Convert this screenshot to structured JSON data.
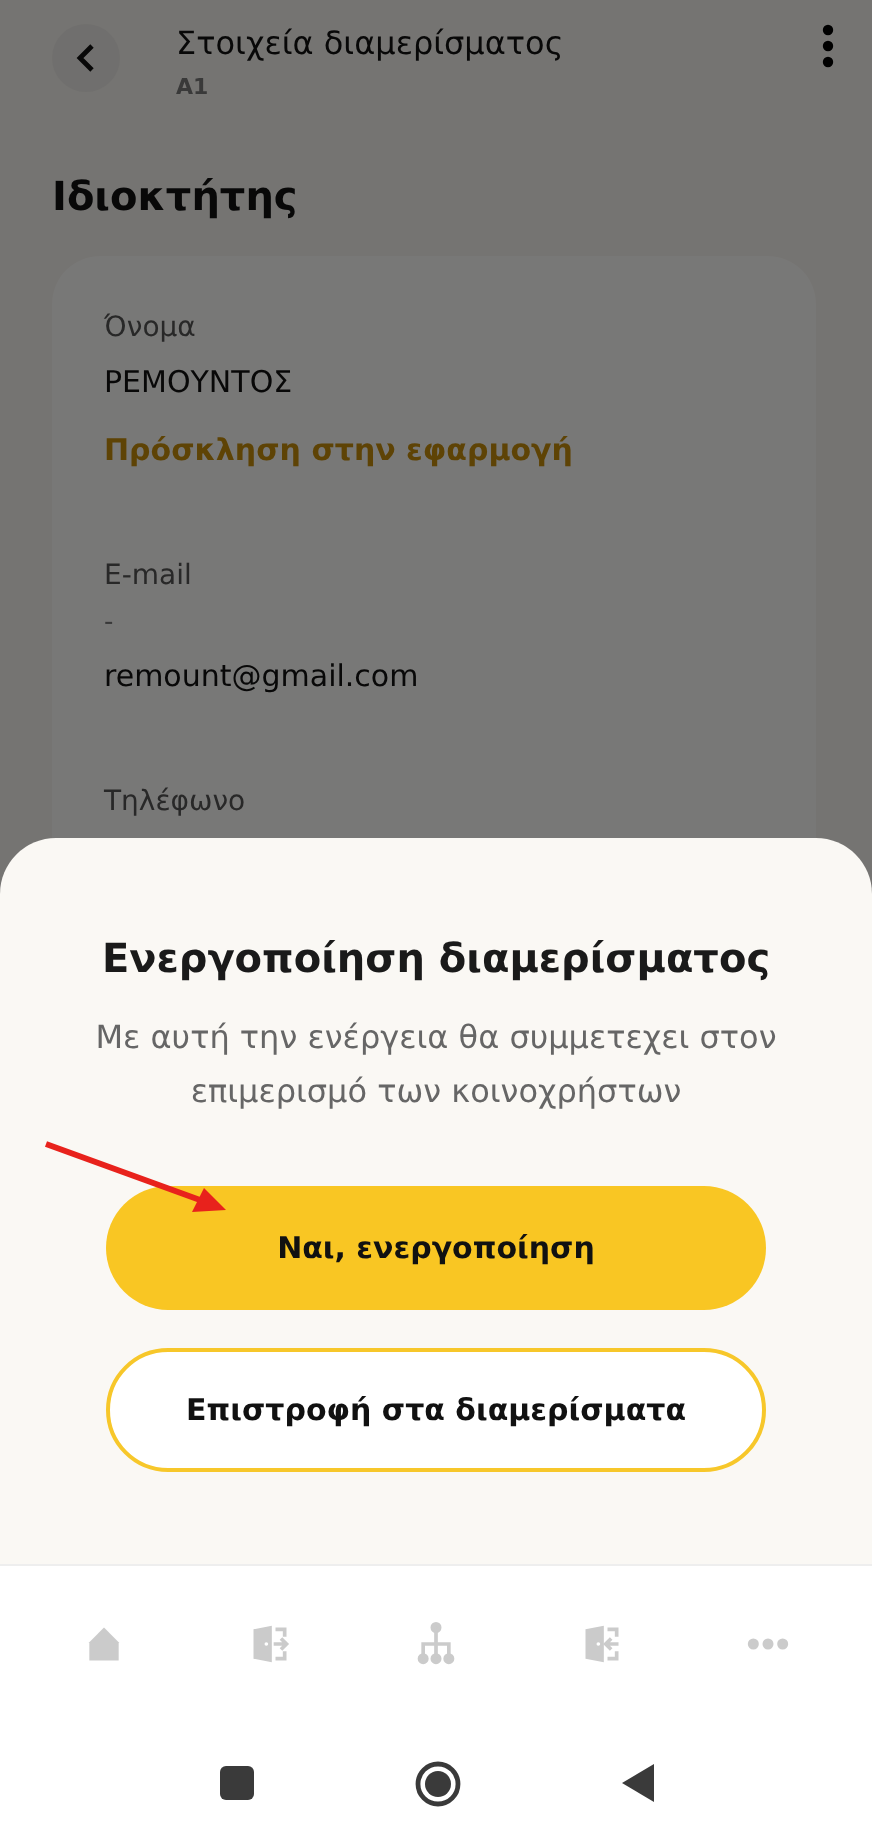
{
  "header": {
    "title": "Στοιχεία διαμερίσματος",
    "subtitle": "A1"
  },
  "section_title": "Ιδιοκτήτης",
  "owner_card": {
    "fields": [
      {
        "label": "Όνομα",
        "value": "ΡΕΜΟΥΝΤΟΣ",
        "link": "Πρόσκληση στην εφαρμογή"
      },
      {
        "label": "E-mail",
        "note": "-",
        "value": "remount@gmail.com"
      },
      {
        "label": "Τηλέφωνο"
      }
    ]
  },
  "dialog": {
    "title": "Ενεργοποίηση διαμερίσματος",
    "message": "Με αυτή την ενέργεια θα συμμετεχει στον επιμερισμό των κοινοχρήστων",
    "buttons": [
      {
        "label": "Ναι, ενεργοποίηση",
        "kind": "primary"
      },
      {
        "label": "Επιστροφή στα διαμερίσματα",
        "kind": "secondary"
      }
    ]
  },
  "bottom_nav": [
    {
      "kind": "home"
    },
    {
      "kind": "door-out"
    },
    {
      "kind": "tree"
    },
    {
      "kind": "door-in"
    },
    {
      "kind": "more"
    }
  ]
}
